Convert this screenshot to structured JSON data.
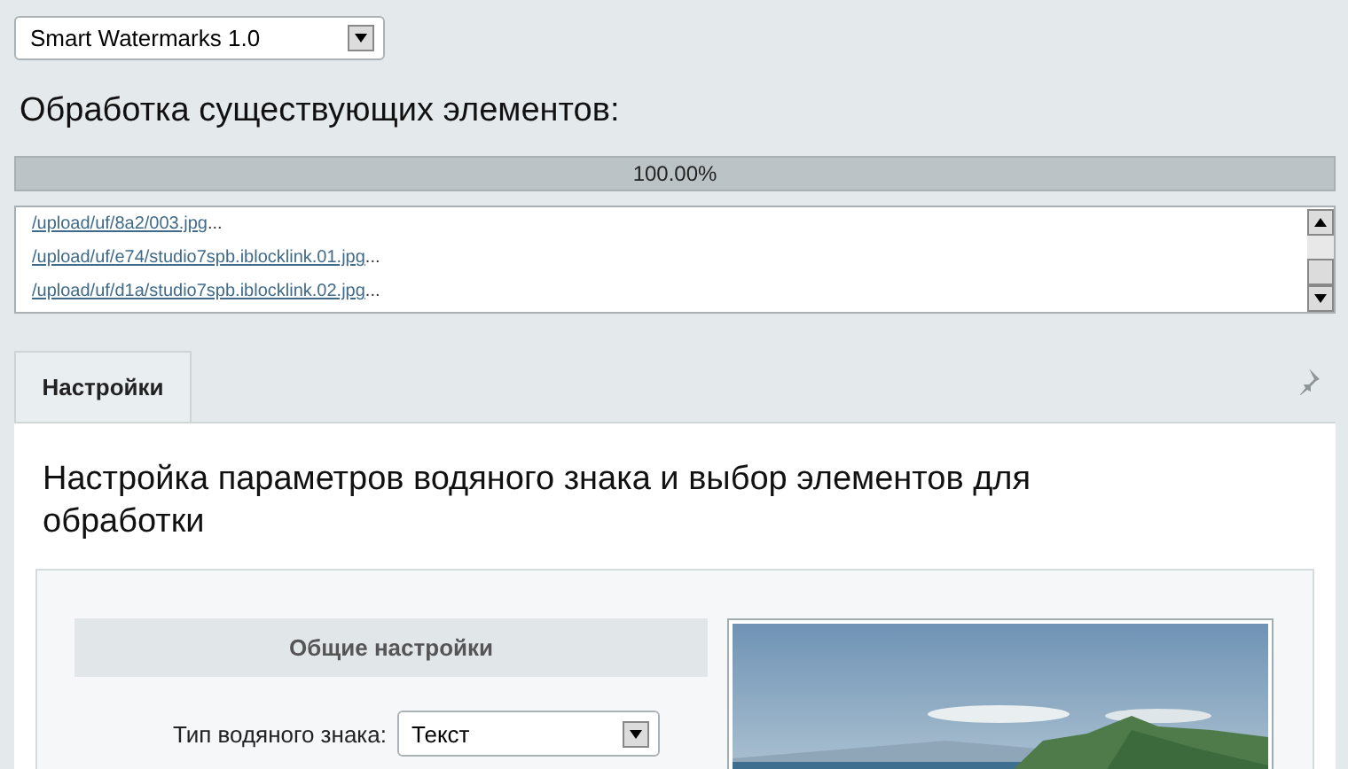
{
  "module_select": {
    "value": "Smart Watermarks 1.0"
  },
  "heading": "Обработка существующих элементов:",
  "progress": {
    "level": 1.0,
    "label": "100.00%"
  },
  "log": [
    {
      "path": "/upload/uf/8a2/003.jpg",
      "suffix": "..."
    },
    {
      "path": "/upload/uf/e74/studio7spb.iblocklink.01.jpg",
      "suffix": "..."
    },
    {
      "path": "/upload/uf/d1a/studio7spb.iblocklink.02.jpg",
      "suffix": "..."
    }
  ],
  "tabs": [
    {
      "label": "Настройки",
      "selected": true
    }
  ],
  "panel_title": "Настройка параметров водяного знака и выбор элементов для обработки",
  "section_header": "Общие настройки",
  "fields": [
    {
      "label": "Тип водяного знака:",
      "value": "Текст"
    }
  ]
}
